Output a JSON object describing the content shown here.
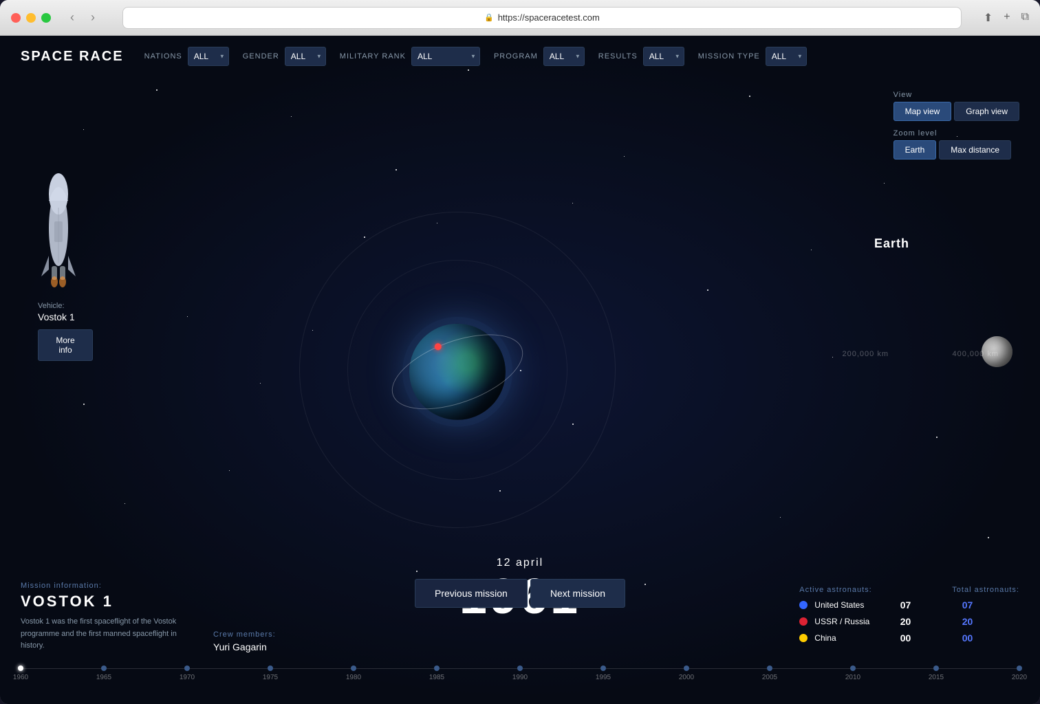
{
  "browser": {
    "url": "https://spaceracetest.com"
  },
  "app": {
    "title": "SPACE RACE"
  },
  "filters": {
    "nations_label": "NATIONS",
    "nations_value": "ALL",
    "gender_label": "GENDER",
    "gender_value": "ALL",
    "military_rank_label": "MILITARY RANK",
    "military_rank_value": "ALL",
    "program_label": "PROGRAM",
    "program_value": "ALL",
    "results_label": "RESULTS",
    "results_value": "ALL",
    "mission_type_label": "MISSION TYPE",
    "mission_type_value": "ALL"
  },
  "view_controls": {
    "label": "View",
    "map_view": "Map view",
    "graph_view": "Graph view"
  },
  "zoom_controls": {
    "label": "Zoom level",
    "earth": "Earth",
    "max_distance": "Max distance"
  },
  "vehicle": {
    "label": "Vehicle:",
    "name": "Vostok 1",
    "more_info": "More info"
  },
  "mission": {
    "info_label": "Mission information:",
    "name": "VOSTOK 1",
    "description": "Vostok 1 was the first spaceflight of the Vostok  programme and the first manned spaceflight  in history.",
    "crew_label": "Crew members:",
    "crew_name": "Yuri Gagarin"
  },
  "date": {
    "day_month": "12 april",
    "year": "1961"
  },
  "navigation": {
    "previous": "Previous mission",
    "next": "Next mission"
  },
  "astronauts": {
    "active_label": "Active astronauts:",
    "total_label": "Total astronauts:",
    "countries": [
      {
        "name": "United States",
        "color": "#3366ff",
        "active": "07",
        "total": "07"
      },
      {
        "name": "USSR / Russia",
        "color": "#dd2233",
        "active": "20",
        "total": "20"
      },
      {
        "name": "China",
        "color": "#ffcc00",
        "active": "00",
        "total": "00"
      }
    ]
  },
  "map": {
    "earth_label": "Earth",
    "distance_200": "200,000 km",
    "distance_400": "400,000 km"
  },
  "timeline": {
    "years": [
      "1960",
      "1965",
      "1970",
      "1975",
      "1980",
      "1985",
      "1990",
      "1995",
      "2000",
      "2005",
      "2010",
      "2015",
      "2020"
    ],
    "active_index": 0
  }
}
